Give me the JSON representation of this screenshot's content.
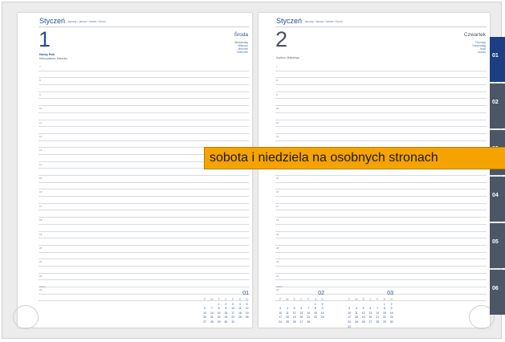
{
  "banner_text": "sobota i niedziela na osobnych stronach",
  "month_title": "Styczeń",
  "month_subtitle": "January / Januar / Janvier / Enero",
  "left_page": {
    "day_number": "1",
    "weekday": "Środa",
    "weekday_translations": [
      "Wednesday",
      "Mittwoch",
      "Mercredi",
      "Miércoles"
    ],
    "holiday": "Nowy Rok",
    "name_days": "Mieczysława, Mieszka"
  },
  "right_page": {
    "day_number": "2",
    "weekday": "Czwartek",
    "weekday_translations": [
      "Thursday",
      "Donnerstag",
      "Jeudi",
      "Jueves"
    ],
    "name_days": "Izydora, Makarego"
  },
  "hours": [
    "7",
    "",
    "8",
    "",
    "9",
    "",
    "10",
    "",
    "11",
    "",
    "12",
    "",
    "13",
    "",
    "14",
    "",
    "15",
    "",
    "16",
    "",
    "17",
    "",
    "18",
    "",
    "19",
    "",
    "20",
    "",
    "21",
    "",
    "22",
    "",
    "23",
    ""
  ],
  "notes_label": "notes",
  "mini_calendars": [
    {
      "month": "01",
      "days": [
        "",
        "",
        "1",
        "2",
        "3",
        "4",
        "5",
        "6",
        "7",
        "8",
        "9",
        "10",
        "11",
        "12",
        "13",
        "14",
        "15",
        "16",
        "17",
        "18",
        "19",
        "20",
        "21",
        "22",
        "23",
        "24",
        "25",
        "26",
        "27",
        "28",
        "29",
        "30",
        "31"
      ]
    },
    {
      "month": "02",
      "days": [
        "",
        "",
        "",
        "",
        "",
        "1",
        "2",
        "3",
        "4",
        "5",
        "6",
        "7",
        "8",
        "9",
        "10",
        "11",
        "12",
        "13",
        "14",
        "15",
        "16",
        "17",
        "18",
        "19",
        "20",
        "21",
        "22",
        "23",
        "24",
        "25",
        "26",
        "27",
        "28"
      ]
    },
    {
      "month": "03",
      "days": [
        "",
        "",
        "",
        "",
        "",
        "1",
        "2",
        "3",
        "4",
        "5",
        "6",
        "7",
        "8",
        "9",
        "10",
        "11",
        "12",
        "13",
        "14",
        "15",
        "16",
        "17",
        "18",
        "19",
        "20",
        "21",
        "22",
        "23",
        "24",
        "25",
        "26",
        "27",
        "28",
        "29",
        "30",
        "31"
      ]
    }
  ],
  "weekday_initials": [
    "P",
    "W",
    "Ś",
    "C",
    "P",
    "S",
    "N"
  ],
  "tabs": [
    {
      "label": "01",
      "active": true
    },
    {
      "label": "02",
      "active": false
    },
    {
      "label": "03",
      "active": false
    },
    {
      "label": "04",
      "active": false
    },
    {
      "label": "05",
      "active": false
    },
    {
      "label": "06",
      "active": false
    }
  ],
  "colors": {
    "accent": "#1c3f83",
    "tab_inactive": "#4b5766",
    "banner": "#f5a300"
  }
}
